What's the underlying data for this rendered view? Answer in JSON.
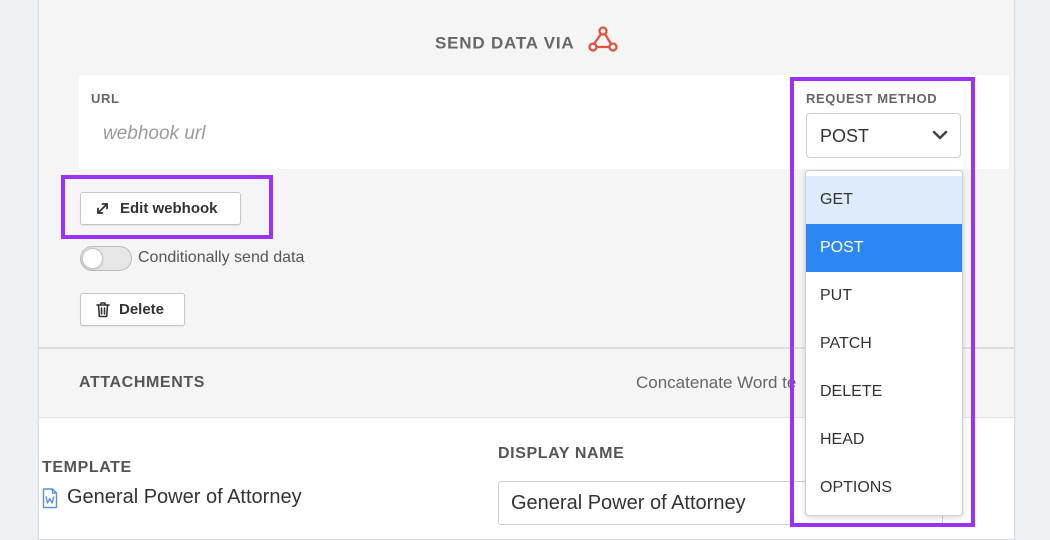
{
  "send_section": {
    "title": "SEND DATA VIA",
    "icon": "webhook-icon",
    "url_label": "URL",
    "url_placeholder": "webhook url",
    "url_value": ""
  },
  "request_method": {
    "label": "REQUEST METHOD",
    "selected": "POST",
    "options": [
      "GET",
      "POST",
      "PUT",
      "PATCH",
      "DELETE",
      "HEAD",
      "OPTIONS"
    ],
    "hovered_option": "GET"
  },
  "actions": {
    "edit_label": "Edit webhook",
    "edit_icon": "expand-arrows-icon",
    "delete_label": "Delete",
    "delete_icon": "trash-icon"
  },
  "conditional": {
    "label": "Conditionally send data",
    "enabled": false
  },
  "attachments": {
    "title": "ATTACHMENTS",
    "concat_label": "Concatenate Word te",
    "template_label": "TEMPLATE",
    "template_name": "General Power of Attorney",
    "display_name_label": "DISPLAY NAME",
    "display_name_value": "General Power of Attorney"
  },
  "colors": {
    "highlight": "#9b30ff",
    "selected_option": "#2e86f5",
    "hovered_option": "#deebfb",
    "webhook_icon": "#e0533e",
    "doc_icon": "#5b8fd6"
  }
}
